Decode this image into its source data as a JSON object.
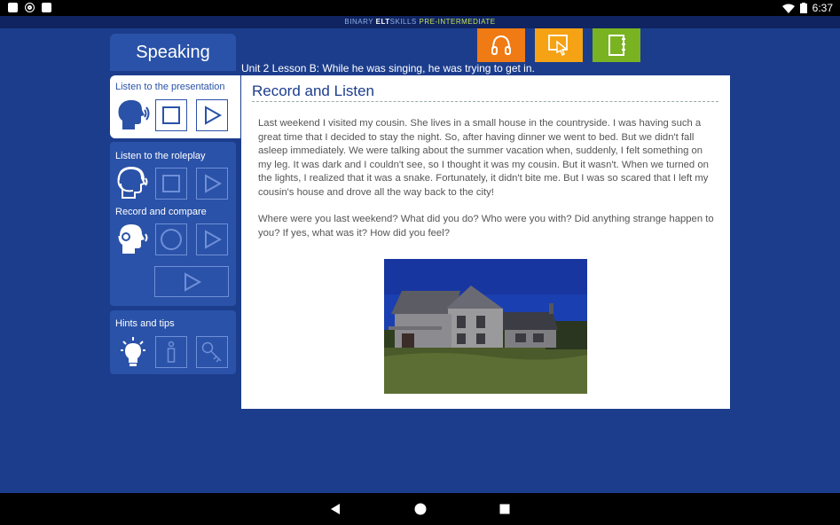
{
  "status_bar": {
    "time": "6:37",
    "icons": [
      "notification-a-icon",
      "sync-icon",
      "sd-card-icon",
      "wifi-icon",
      "battery-icon"
    ]
  },
  "app_bar": {
    "brand": "BINARY ",
    "brand_bold": "ELT",
    "brand_suffix": "SKILLS ",
    "level": "PRE-INTERMEDIATE"
  },
  "section_tab": {
    "label": "Speaking"
  },
  "top_buttons": [
    {
      "name": "listen-button",
      "icon": "headphones-icon",
      "color": "#f07a14"
    },
    {
      "name": "interact-button",
      "icon": "touch-icon",
      "color": "#f5a214"
    },
    {
      "name": "notebook-button",
      "icon": "notebook-icon",
      "color": "#7ab321"
    }
  ],
  "lesson_title": "Unit 2 Lesson B: While he was singing, he was trying to get in.",
  "sidebar": {
    "presentation_label": "Listen to the presentation",
    "roleplay_label": "Listen to the roleplay",
    "record_label": "Record and compare",
    "hints_label": "Hints and tips"
  },
  "content": {
    "heading": "Record and Listen",
    "paragraph1": "Last weekend I visited my cousin. She lives in a small house in the countryside. I was having such a great time that I decided to stay the night. So, after having dinner we went to bed. But we didn't fall asleep immediately. We were talking about the summer vacation when, suddenly, I felt something on my leg. It was dark and I couldn't see, so I thought it was my cousin. But it wasn't. When we turned on the lights, I realized that it was a snake. Fortunately, it didn't bite me. But I was so scared that I left my cousin's house and drove all the way back to the city!",
    "paragraph2": "Where were you last weekend? What did you do? Who were you with? Did anything strange happen to you? If yes, what was it? How did you feel?"
  },
  "colors": {
    "background": "#1c3d8c",
    "panel": "#2a52a8",
    "accent_orange": "#f07a14",
    "accent_yellow": "#f5a214",
    "accent_green": "#7ab321"
  }
}
